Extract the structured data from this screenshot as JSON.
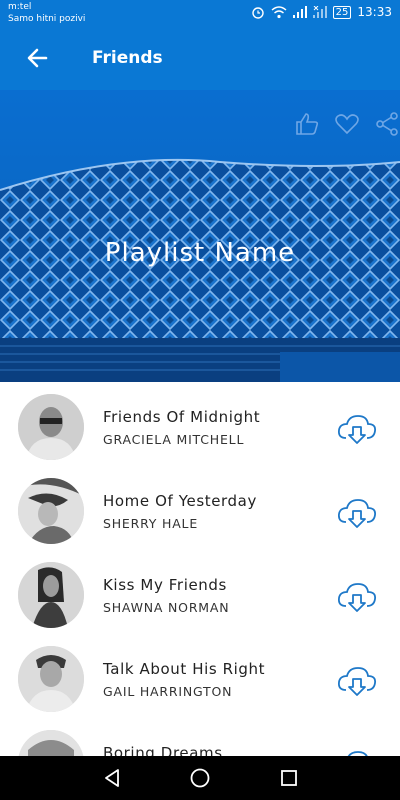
{
  "status_bar": {
    "carrier": "m:tel",
    "carrier_note": "Samo hitni pozivi",
    "battery": "25",
    "time": "13:33"
  },
  "app_bar": {
    "title": "Friends",
    "back_icon": "arrow-left-icon"
  },
  "hero": {
    "playlist_name": "Playlist Name",
    "actions": [
      "thumbs-up-icon",
      "heart-icon",
      "share-icon"
    ]
  },
  "tracks": [
    {
      "title": "Friends Of Midnight",
      "artist": "GRACIELA MITCHELL"
    },
    {
      "title": "Home Of Yesterday",
      "artist": "SHERRY HALE"
    },
    {
      "title": "Kiss My Friends",
      "artist": "SHAWNA NORMAN"
    },
    {
      "title": "Talk About His Right",
      "artist": "GAIL HARRINGTON"
    },
    {
      "title": "Boring Dreams",
      "artist": ""
    }
  ],
  "nav": [
    "back-triangle-icon",
    "home-circle-icon",
    "recents-square-icon"
  ],
  "colors": {
    "primary": "#0a78d4",
    "accent_icon": "#1e78c8"
  }
}
